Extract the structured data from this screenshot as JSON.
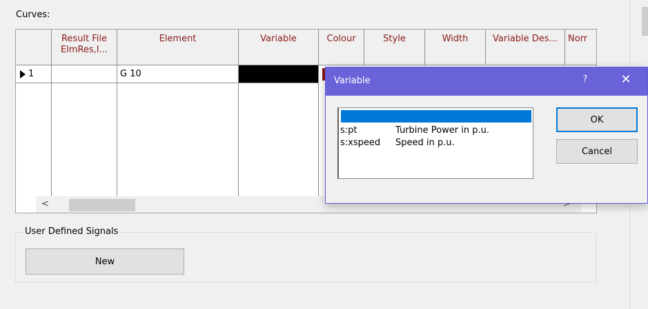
{
  "curves_label": "Curves:",
  "grid": {
    "columns": [
      {
        "label": ""
      },
      {
        "label": "Result File ElmRes,I..."
      },
      {
        "label": "Element"
      },
      {
        "label": "Variable"
      },
      {
        "label": "Colour"
      },
      {
        "label": "Style"
      },
      {
        "label": "Width"
      },
      {
        "label": "Variable Des..."
      },
      {
        "label": "Norr"
      }
    ],
    "rows": [
      {
        "row_number": "1",
        "result_file": "",
        "element": "G 10",
        "variable": "",
        "variable_color": "#000000"
      }
    ]
  },
  "user_defined_signals": {
    "title": "User Defined Signals",
    "new_label": "New"
  },
  "dialog": {
    "title": "Variable",
    "help_label": "?",
    "close_label": "✕",
    "variables": [
      {
        "name": "",
        "description": "",
        "selected": true
      },
      {
        "name": "s:pt",
        "description": "Turbine Power in p.u."
      },
      {
        "name": "s:xspeed",
        "description": "Speed in p.u."
      }
    ],
    "ok_label": "OK",
    "cancel_label": "Cancel"
  },
  "scrollbar": {
    "left_arrow": "<",
    "right_arrow": ">"
  },
  "colors": {
    "header_text": "#8b1a1a",
    "dialog_title_bg": "#6a62d8",
    "selection": "#0078d7"
  }
}
